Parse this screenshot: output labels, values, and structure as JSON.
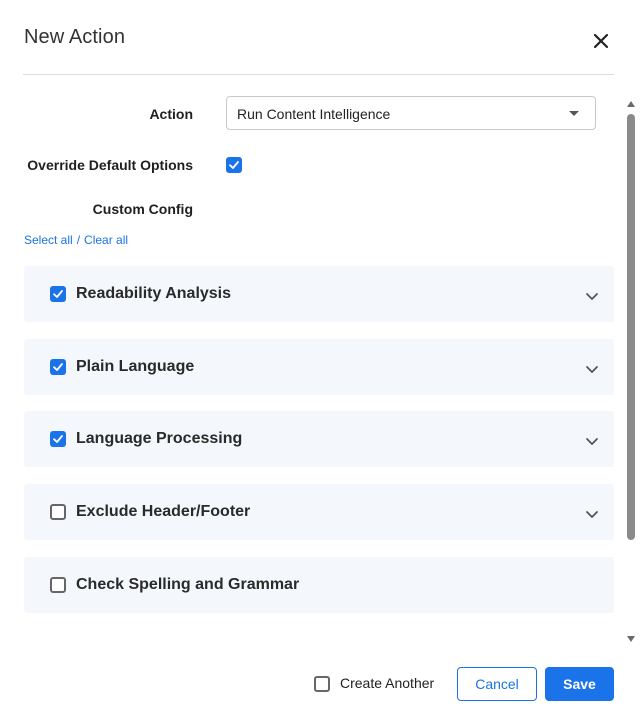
{
  "dialog": {
    "title": "New Action",
    "close_icon": "close-icon"
  },
  "form": {
    "action_label": "Action",
    "action_value": "Run Content Intelligence",
    "override_label": "Override Default Options",
    "override_checked": true,
    "custom_config_label": "Custom Config",
    "select_all": "Select all",
    "separator": "/",
    "clear_all": "Clear all"
  },
  "sections": [
    {
      "label": "Readability Analysis",
      "checked": true,
      "expandable": true
    },
    {
      "label": "Plain Language",
      "checked": true,
      "expandable": true
    },
    {
      "label": "Language Processing",
      "checked": true,
      "expandable": true
    },
    {
      "label": "Exclude Header/Footer",
      "checked": false,
      "expandable": true
    },
    {
      "label": "Check Spelling and Grammar",
      "checked": false,
      "expandable": false
    }
  ],
  "footer": {
    "create_another_label": "Create Another",
    "create_another_checked": false,
    "cancel_label": "Cancel",
    "save_label": "Save"
  },
  "colors": {
    "accent": "#1a73e8",
    "section_bg": "#f4f7fb"
  }
}
